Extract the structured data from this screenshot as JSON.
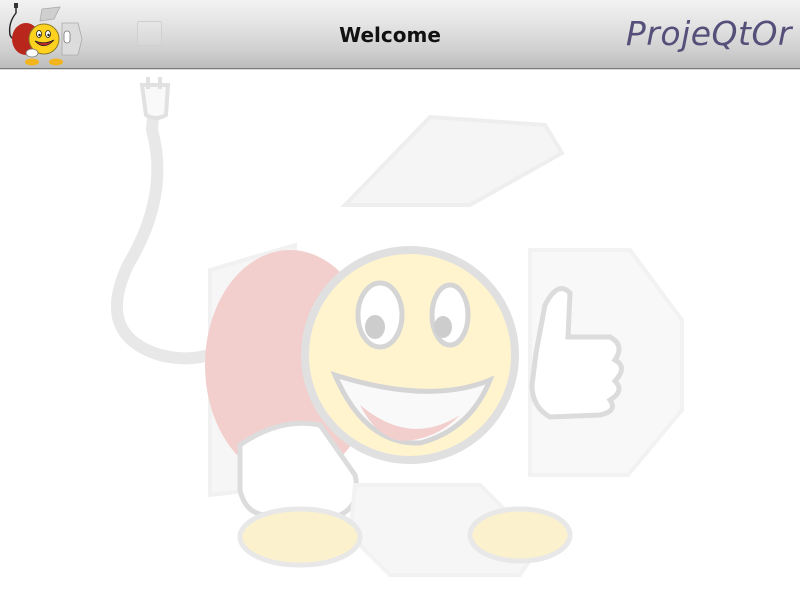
{
  "header": {
    "title": "Welcome",
    "brand": "ProjeQtOr"
  },
  "icons": {
    "logo": "projeqtor-mascot-logo-icon",
    "menu": "menu-toggle-icon",
    "watermark": "projeqtor-mascot-watermark"
  },
  "colors": {
    "brand_text": "#54507a",
    "mascot_face": "#ffd21f",
    "mascot_body": "#c8281e"
  }
}
